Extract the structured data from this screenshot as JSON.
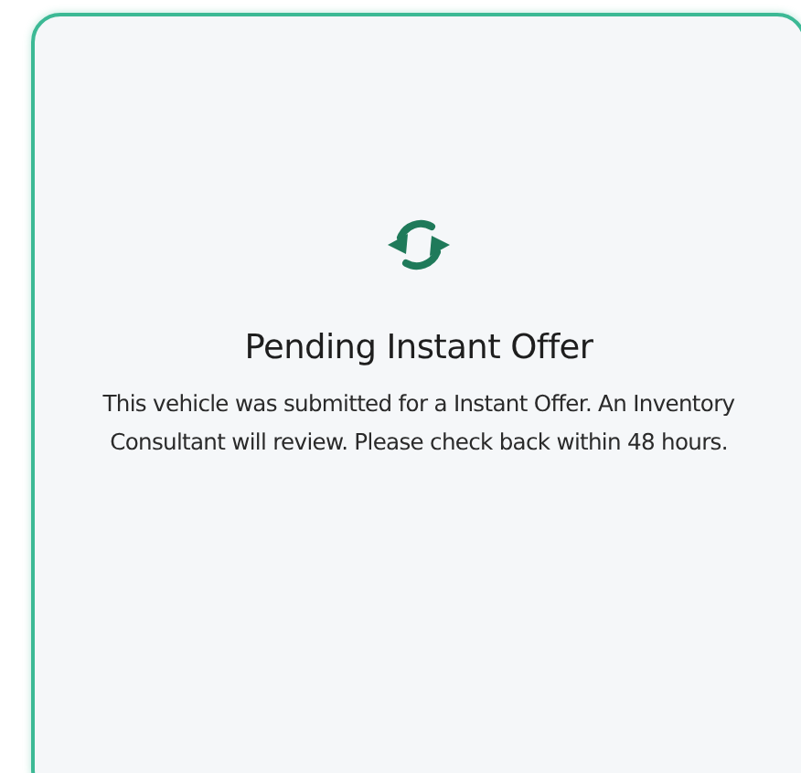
{
  "card": {
    "title": "Pending Instant Offer",
    "message": "This vehicle was submitted for a Instant Offer. An Inventory Consultant will review. Please check back within 48 hours."
  }
}
